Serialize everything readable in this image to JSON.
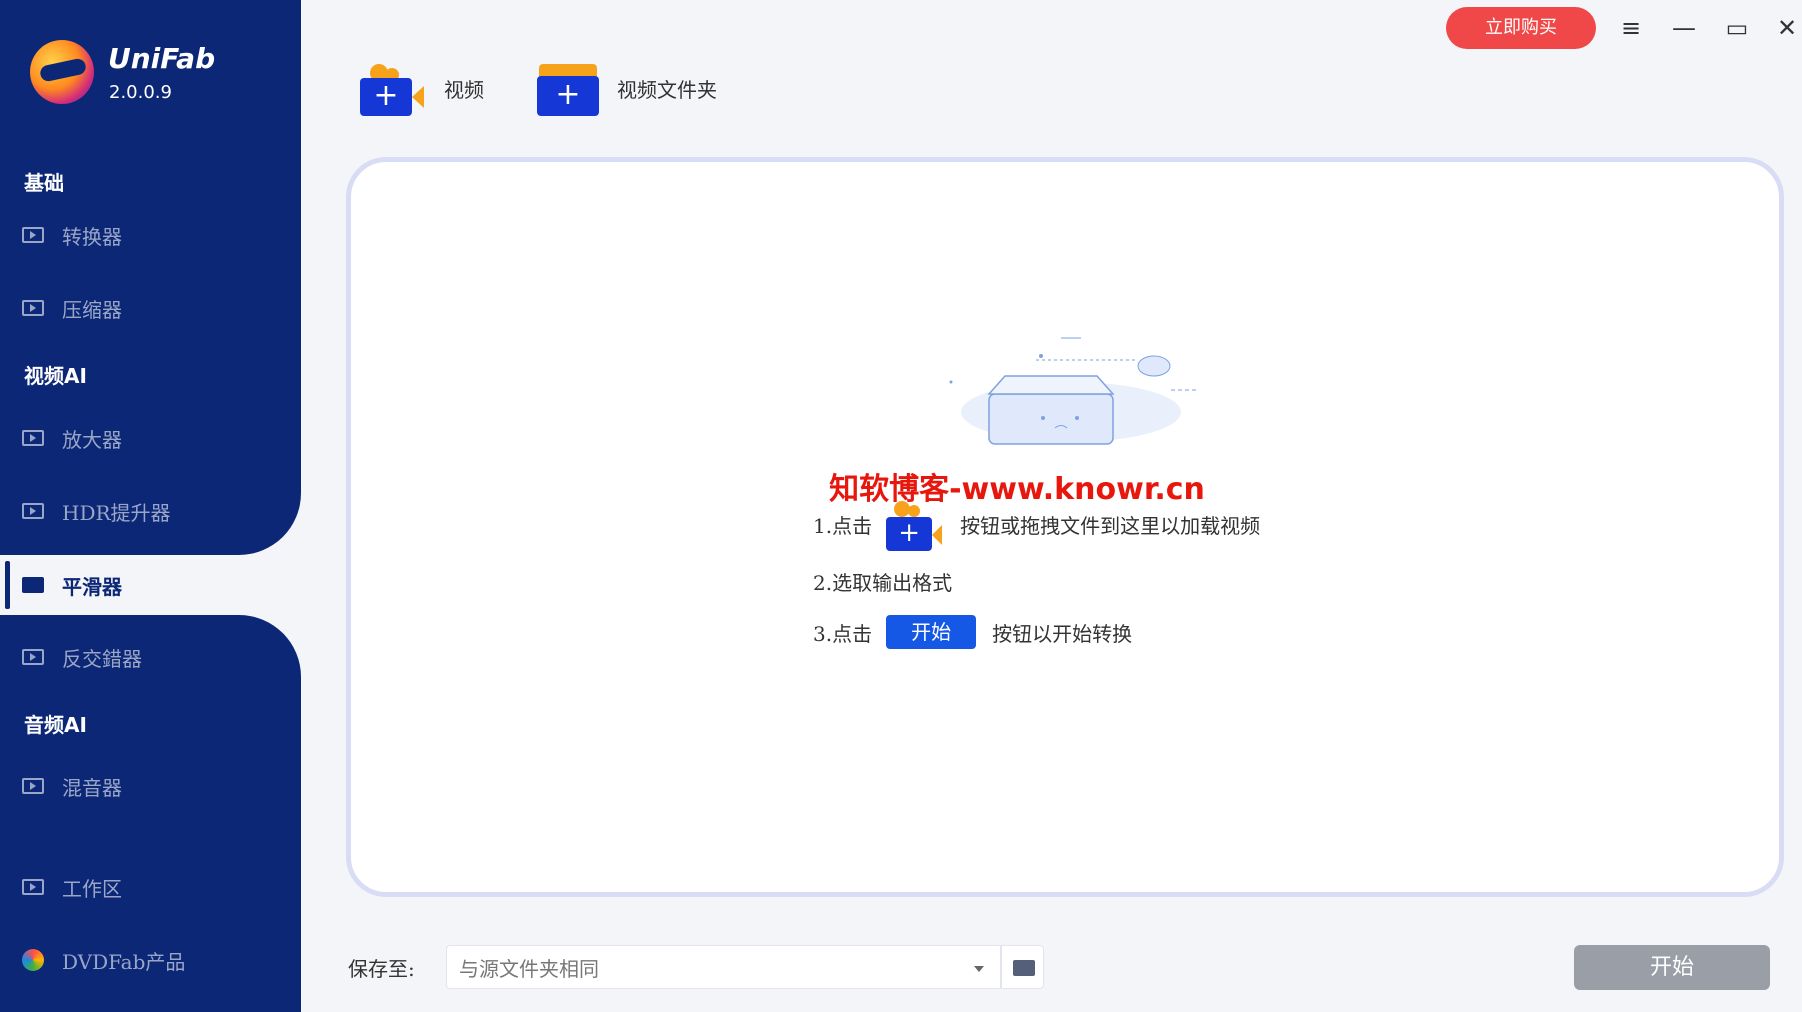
{
  "app": {
    "name": "UniFab",
    "version": "2.0.0.9"
  },
  "sidebar": {
    "section_basic": "基础",
    "converter": "转换器",
    "compressor": "压缩器",
    "section_video_ai": "视频AI",
    "upscaler": "放大器",
    "hdr_upconverter": "HDR提升器",
    "smoother": "平滑器",
    "deinterlacer": "反交錯器",
    "section_audio_ai": "音频AI",
    "audio_mixer": "混音器",
    "workspace": "工作区",
    "dvdfab_products": "DVDFab产品"
  },
  "topbar": {
    "buy_now": "立即购买",
    "menu_icon": "≡",
    "minimize_icon": "—",
    "maximize_icon": "▭",
    "close_icon": "✕"
  },
  "import": {
    "video_label": "视频",
    "video_folder_label": "视频文件夹"
  },
  "dropzone": {
    "watermark": "知软博客-www.knowr.cn",
    "step1_prefix": "1.点击",
    "step1_suffix": "按钮或拖拽文件到这里以加载视频",
    "step2": "2.选取输出格式",
    "step3_prefix": "3.点击",
    "step3_button": "开始",
    "step3_suffix": "按钮以开始转换"
  },
  "bottom": {
    "save_to_label": "保存至:",
    "save_to_value": "与源文件夹相同",
    "start_button": "开始"
  },
  "colors": {
    "sidebar": "#0c2776",
    "buy": "#f04848",
    "accent": "#1537d6",
    "start_disabled": "#9a9ea6"
  }
}
